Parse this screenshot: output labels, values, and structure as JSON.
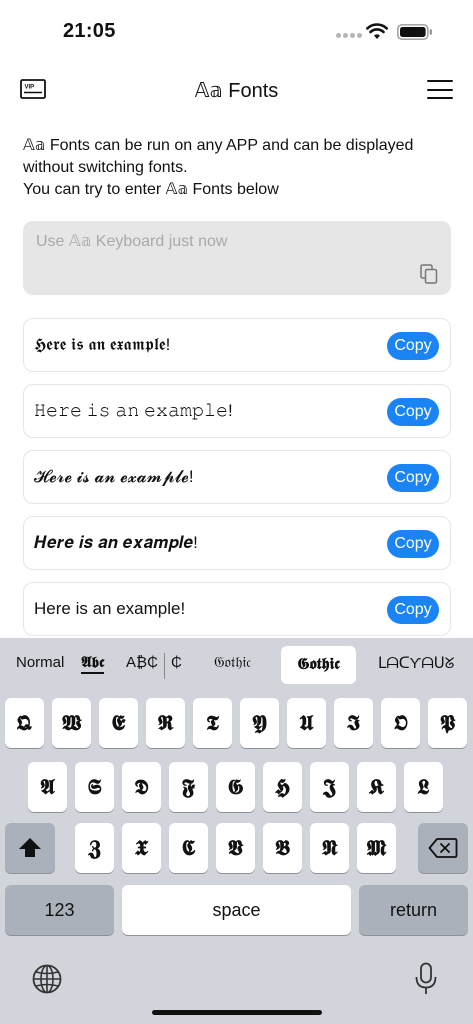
{
  "status_bar": {
    "time": "21:05"
  },
  "header": {
    "title": "𝔸𝕒 Fonts"
  },
  "description": {
    "line1": "𝔸𝕒 Fonts can be run on any APP and can be displayed without switching fonts.",
    "line2": "You can try to enter 𝔸𝕒 Fonts below"
  },
  "input": {
    "placeholder": "Use 𝔸𝕒 Keyboard just now",
    "value": ""
  },
  "examples": [
    {
      "text": "𝕳𝖊𝖗𝖊 𝖎𝖘 𝖆𝖓 𝖊𝖝𝖆𝖒𝖕𝖑𝖊!",
      "copy_label": "Copy"
    },
    {
      "text": "𝙷𝚎𝚛𝚎 𝚒𝚜 𝚊𝚗 𝚎𝚡𝚊𝚖𝚙𝚕𝚎!",
      "copy_label": "Copy"
    },
    {
      "text": "𝓗𝓮𝓻𝓮 𝓲𝓼 𝓪𝓷 𝓮𝔁𝓪𝓶𝓹𝓵𝓮!",
      "copy_label": "Copy"
    },
    {
      "text": "𝑯𝒆𝒓𝒆 𝒊𝒔 𝒂𝒏 𝒆𝒙𝒂𝒎𝒑𝒍𝒆!",
      "copy_label": "Copy"
    },
    {
      "text": "Here is an example!",
      "copy_label": "Copy"
    }
  ],
  "keyboard": {
    "styles": [
      "Normal",
      "𝕬𝖇𝖈",
      "A₿₵",
      "₵",
      "𝔊𝔬𝔱𝔥𝔦𝔠",
      "𝕲𝖔𝖙𝖍𝖎𝖈",
      "ᒪᗩᑕƳᗩᑌᘜ"
    ],
    "row1": [
      "𝕼",
      "𝖂",
      "𝕰",
      "𝕽",
      "𝕿",
      "𝖄",
      "𝖀",
      "𝕴",
      "𝕺",
      "𝕻"
    ],
    "row2": [
      "𝕬",
      "𝕾",
      "𝕯",
      "𝕱",
      "𝕲",
      "𝕳",
      "𝕵",
      "𝕶",
      "𝕷"
    ],
    "row3": [
      "𝖅",
      "𝖃",
      "𝕮",
      "𝖁",
      "𝕭",
      "𝕹",
      "𝕸"
    ],
    "numbers_label": "123",
    "space_label": "space",
    "return_label": "return"
  }
}
